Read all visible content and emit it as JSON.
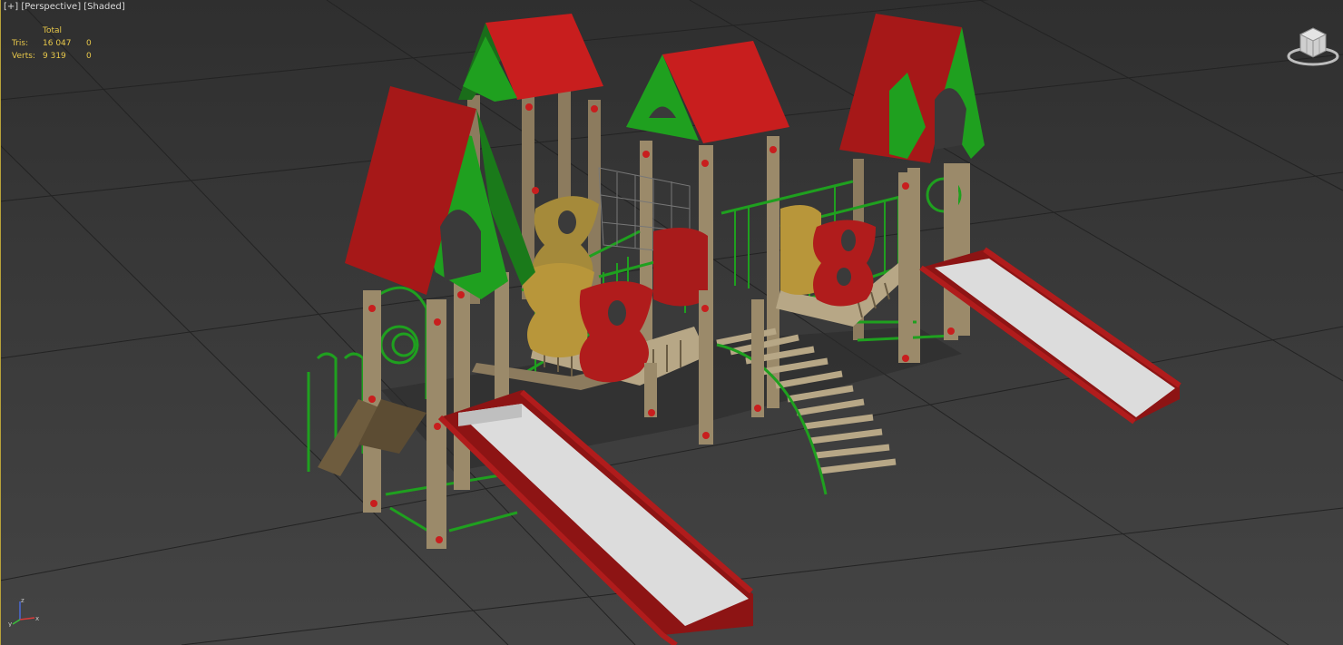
{
  "viewport": {
    "menu_plus": "[+]",
    "view_name": "[Perspective]",
    "shading_mode": "[Shaded]"
  },
  "stats": {
    "header": "Total",
    "rows": [
      {
        "label": "Tris:",
        "total": "16 047",
        "selected": "0"
      },
      {
        "label": "Verts:",
        "total": "9 319",
        "selected": "0"
      }
    ]
  },
  "gizmo": {
    "axis_x": "x",
    "axis_y": "y",
    "axis_z": "z"
  },
  "colors": {
    "viewport_bg": "#3a3a3a",
    "grid_line": "#222222",
    "roof_red": "#c81e1e",
    "frame_green": "#1fa01f",
    "post_wood": "#9b8a6a",
    "slide_grey": "#d8d8d8",
    "stats_text": "#e8c84a"
  }
}
